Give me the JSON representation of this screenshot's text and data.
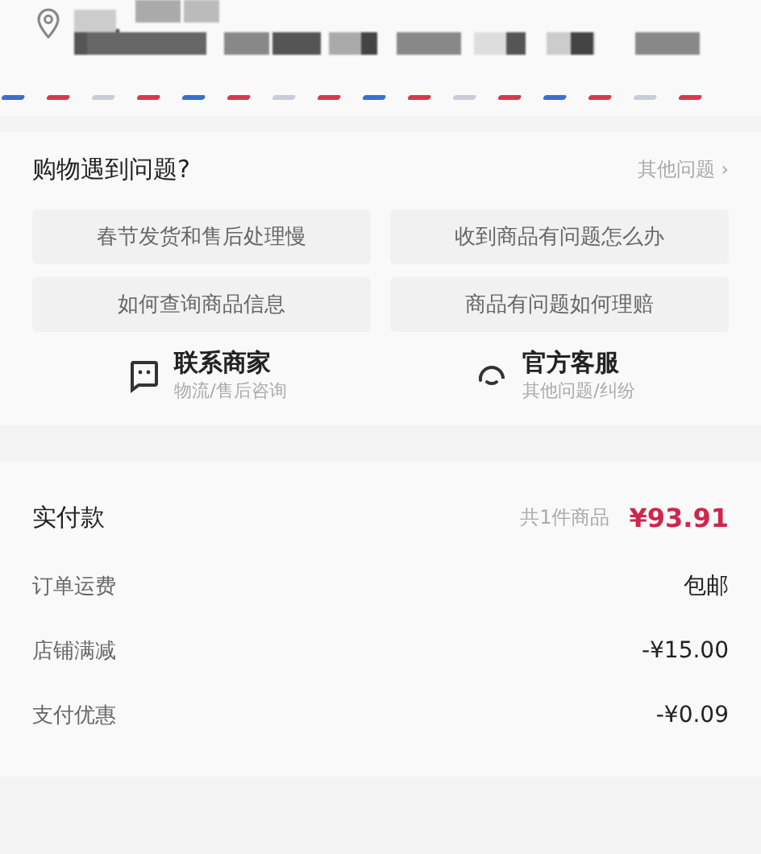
{
  "help": {
    "title": "购物遇到问题?",
    "more": "其他问题 ›",
    "topics": [
      "春节发货和售后处理慢",
      "收到商品有问题怎么办",
      "如何查询商品信息",
      "商品有问题如何理赔"
    ],
    "contacts": [
      {
        "kind": "merchant",
        "name": "联系商家",
        "sub": "物流/售后咨询"
      },
      {
        "kind": "service",
        "name": "官方客服",
        "sub": "其他问题/纠纷"
      }
    ]
  },
  "payment": {
    "label": "实付款",
    "count": "共1件商品",
    "total": "¥93.91",
    "rows": [
      {
        "label": "订单运费",
        "value": "包邮"
      },
      {
        "label": "店铺满减",
        "value": "-¥15.00"
      },
      {
        "label": "支付优惠",
        "value": "-¥0.09"
      }
    ]
  }
}
